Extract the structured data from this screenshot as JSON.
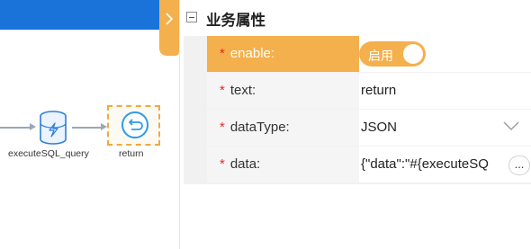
{
  "canvas": {
    "nodes": [
      {
        "label": "executeSQL_query",
        "icon": "database-icon"
      },
      {
        "label": "return",
        "icon": "return-icon"
      }
    ],
    "colors": {
      "top_bar": "#1a73d8",
      "edge": "#9aa6b8",
      "selection": "#f2a93c"
    }
  },
  "panel": {
    "title": "业务属性",
    "collapse_icon": "chevron-right-icon",
    "rows": [
      {
        "required_mark": "*",
        "label": "enable:",
        "toggle_text": "启用",
        "toggle_on": true
      },
      {
        "required_mark": "*",
        "label": "text:",
        "value": "return"
      },
      {
        "required_mark": "*",
        "label": "dataType:",
        "value": "JSON"
      },
      {
        "required_mark": "*",
        "label": "data:",
        "value": "{\"data\":\"#{executeSQ",
        "more_button": "..."
      }
    ],
    "colors": {
      "accent": "#f4b04c",
      "required": "#e22a2a"
    }
  }
}
